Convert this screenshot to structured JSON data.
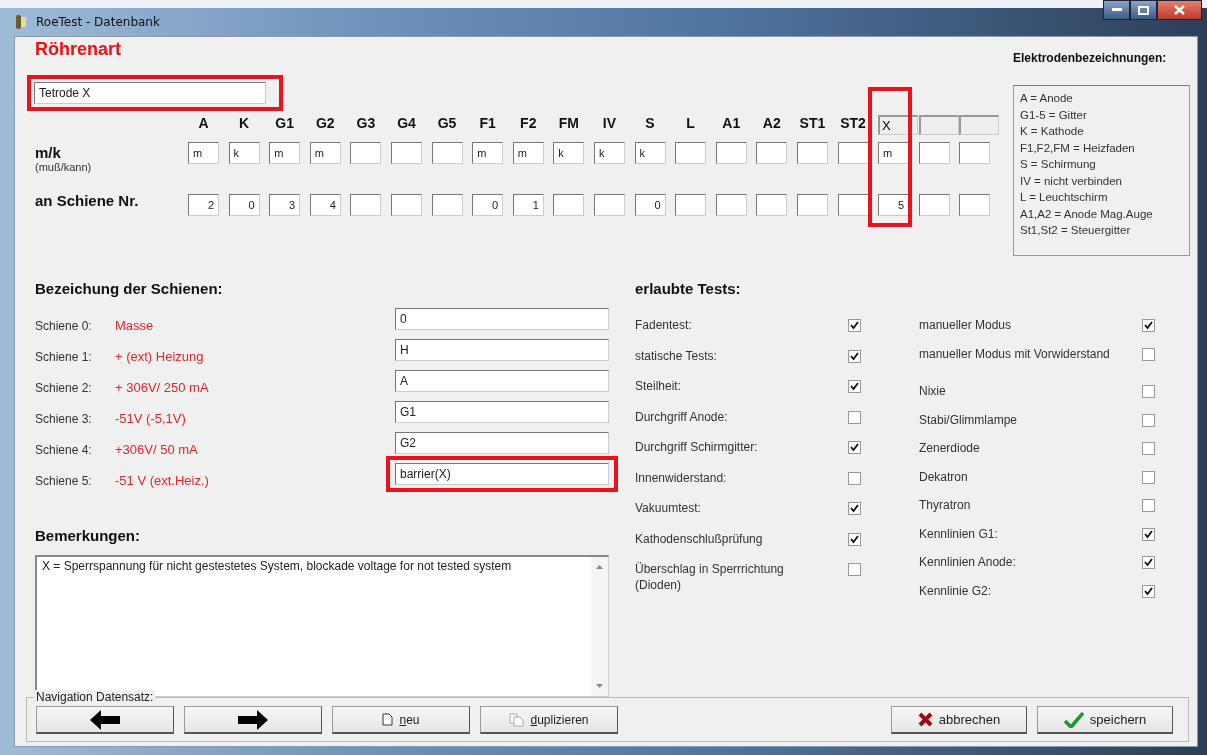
{
  "window": {
    "title": "RoeTest - Datenbank"
  },
  "tube_type": {
    "heading": "Röhrenart",
    "value": "Tetrode X",
    "highlighted": true
  },
  "electrodes": {
    "mk_label": "m/k",
    "mk_hint": "(muß/kann)",
    "rail_label": "an Schiene Nr.",
    "columns": [
      {
        "kind": "label",
        "name": "A",
        "mk": "m",
        "rail": "2",
        "highlighted": false
      },
      {
        "kind": "label",
        "name": "K",
        "mk": "k",
        "rail": "0",
        "highlighted": false
      },
      {
        "kind": "label",
        "name": "G1",
        "mk": "m",
        "rail": "3",
        "highlighted": false
      },
      {
        "kind": "label",
        "name": "G2",
        "mk": "m",
        "rail": "4",
        "highlighted": false
      },
      {
        "kind": "label",
        "name": "G3",
        "highlighted": false
      },
      {
        "kind": "label",
        "name": "G4",
        "highlighted": false
      },
      {
        "kind": "label",
        "name": "G5",
        "highlighted": false
      },
      {
        "kind": "label",
        "name": "F1",
        "mk": "m",
        "rail": "0",
        "highlighted": false
      },
      {
        "kind": "label",
        "name": "F2",
        "mk": "m",
        "rail": "1",
        "highlighted": false
      },
      {
        "kind": "label",
        "name": "FM",
        "mk": "k",
        "highlighted": false
      },
      {
        "kind": "label",
        "name": "IV",
        "mk": "k",
        "highlighted": false
      },
      {
        "kind": "label",
        "name": "S",
        "mk": "k",
        "rail": "0",
        "highlighted": false
      },
      {
        "kind": "label",
        "name": "L",
        "highlighted": false
      },
      {
        "kind": "label",
        "name": "A1",
        "highlighted": false
      },
      {
        "kind": "label",
        "name": "A2",
        "highlighted": false
      },
      {
        "kind": "label",
        "name": "ST1",
        "highlighted": false
      },
      {
        "kind": "label",
        "name": "ST2",
        "highlighted": false
      },
      {
        "kind": "field",
        "name": "X",
        "mk": "m",
        "rail": "5",
        "highlighted": true
      },
      {
        "kind": "field",
        "highlighted": false
      },
      {
        "kind": "field",
        "highlighted": false
      }
    ]
  },
  "legend": {
    "heading": "Elektrodenbezeichnungen:",
    "lines": [
      "A = Anode",
      "G1-5 = Gitter",
      "K = Kathode",
      "F1,F2,FM = Heizfaden",
      "S = Schirmung",
      "IV = nicht verbinden",
      "L = Leuchtschirm",
      "A1,A2 = Anode Mag.Auge",
      "St1,St2 = Steuergitter"
    ]
  },
  "rails": {
    "heading": "Bezeichung der Schienen:",
    "rows": [
      {
        "label": "Schiene 0:",
        "description": "Masse",
        "value": "0",
        "highlighted": false
      },
      {
        "label": "Schiene 1:",
        "description": "+ (ext) Heizung",
        "value": "H",
        "highlighted": false
      },
      {
        "label": "Schiene 2:",
        "description": "+ 306V/ 250 mA",
        "value": "A",
        "highlighted": false
      },
      {
        "label": "Schiene 3:",
        "description": "-51V (-5,1V)",
        "value": "G1",
        "highlighted": false
      },
      {
        "label": "Schiene 4:",
        "description": "+306V/ 50 mA",
        "value": "G2",
        "highlighted": false
      },
      {
        "label": "Schiene 5:",
        "description": "-51 V (ext.Heiz.)",
        "value": "barrier(X)",
        "highlighted": true
      }
    ]
  },
  "remarks": {
    "heading": "Bemerkungen:",
    "text": "X = Sperrspannung für nicht gestestetes System, blockade voltage for not tested system"
  },
  "tests": {
    "heading": "erlaubte Tests:",
    "columns": [
      {
        "items": [
          {
            "label": "Fadentest:",
            "checked": true
          },
          {
            "label": "statische Tests:",
            "checked": true
          },
          {
            "label": "Steilheit:",
            "checked": true
          },
          {
            "label": "Durchgriff Anode:",
            "checked": false
          },
          {
            "label": "Durchgriff Schirmgitter:",
            "checked": true
          },
          {
            "label": "Innenwiderstand:",
            "checked": false
          },
          {
            "label": "Vakuumtest:",
            "checked": true
          },
          {
            "label": "Kathodenschlußprüfung",
            "checked": true
          },
          {
            "label": "Überschlag in Sperrrichtung (Dioden)",
            "checked": false
          }
        ]
      },
      {
        "items": [
          {
            "label": "manueller Modus",
            "checked": true
          },
          {
            "label": "manueller Modus mit Vorwiderstand",
            "checked": false
          },
          {
            "label": "Nixie",
            "checked": false
          },
          {
            "label": "Stabi/Glimmlampe",
            "checked": false
          },
          {
            "label": "Zenerdiode",
            "checked": false
          },
          {
            "label": "Dekatron",
            "checked": false
          },
          {
            "label": "Thyratron",
            "checked": false
          },
          {
            "label": "Kennlinien G1:",
            "checked": true
          },
          {
            "label": "Kennlinien Anode:",
            "checked": true
          },
          {
            "label": "Kennlinie G2:",
            "checked": true
          }
        ]
      }
    ]
  },
  "navigation": {
    "legend": "Navigation Datensatz:",
    "buttons": [
      {
        "kind": "back"
      },
      {
        "kind": "forward"
      },
      {
        "kind": "new",
        "label": "neu"
      },
      {
        "kind": "duplicate",
        "label": "duplizieren"
      }
    ]
  },
  "actions": [
    {
      "kind": "cancel",
      "label": "abbrechen"
    },
    {
      "kind": "save",
      "label": "speichern"
    }
  ]
}
